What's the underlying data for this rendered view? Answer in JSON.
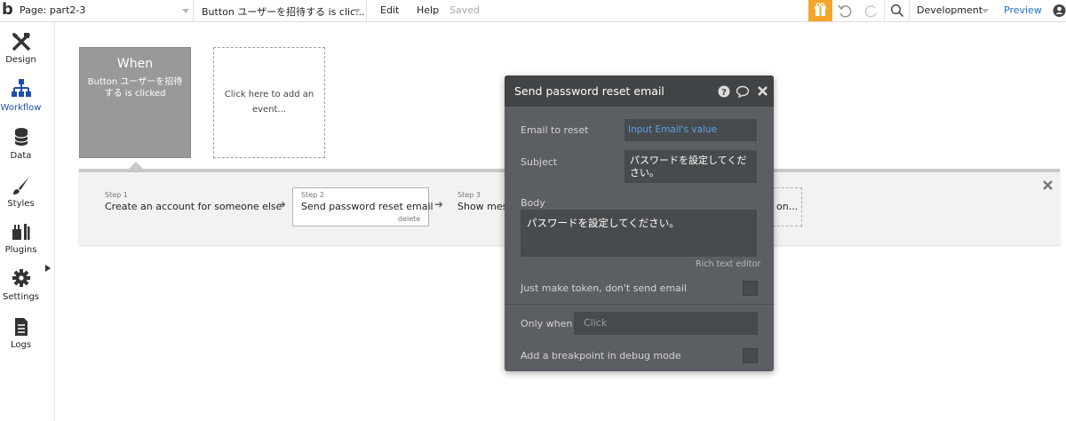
{
  "topbar": {
    "logo": "b",
    "page_label": "Page: part2-3",
    "event_label": "Button ユーザーを招待する is clic...",
    "edit": "Edit",
    "help": "Help",
    "saved": "Saved",
    "env": "Development",
    "preview": "Preview"
  },
  "sidebar": {
    "items": [
      {
        "label": "Design",
        "icon": "design-icon"
      },
      {
        "label": "Workflow",
        "icon": "workflow-icon"
      },
      {
        "label": "Data",
        "icon": "database-icon"
      },
      {
        "label": "Styles",
        "icon": "brush-icon"
      },
      {
        "label": "Plugins",
        "icon": "plug-icon"
      },
      {
        "label": "Settings",
        "icon": "gear-icon"
      },
      {
        "label": "Logs",
        "icon": "document-icon"
      }
    ]
  },
  "canvas": {
    "when_title": "When",
    "when_sub": "Button ユーザーを招待する is clicked",
    "add_event": "Click here to add an event...",
    "steps": [
      {
        "num": "Step 1",
        "name": "Create an account for someone else"
      },
      {
        "num": "Step 2",
        "name": "Send password reset email",
        "delete": "delete"
      },
      {
        "num": "Step 3",
        "name": "Show mess"
      }
    ],
    "step4_text": "on..."
  },
  "panel": {
    "title": "Send password reset email",
    "email_label": "Email to reset",
    "email_value": "Input Email's value",
    "subject_label": "Subject",
    "subject_value": "パスワードを設定してください。",
    "body_label": "Body",
    "body_value": "パスワードを設定してください。",
    "rich_text": "Rich text editor",
    "token_label": "Just make token, don't send email",
    "only_when_label": "Only when",
    "only_when_placeholder": "Click",
    "breakpoint_label": "Add a breakpoint in debug mode"
  },
  "colors": {
    "accent_blue": "#1d4ea8",
    "gift_orange": "#f2a62b",
    "link_blue": "#5aa2e8"
  }
}
